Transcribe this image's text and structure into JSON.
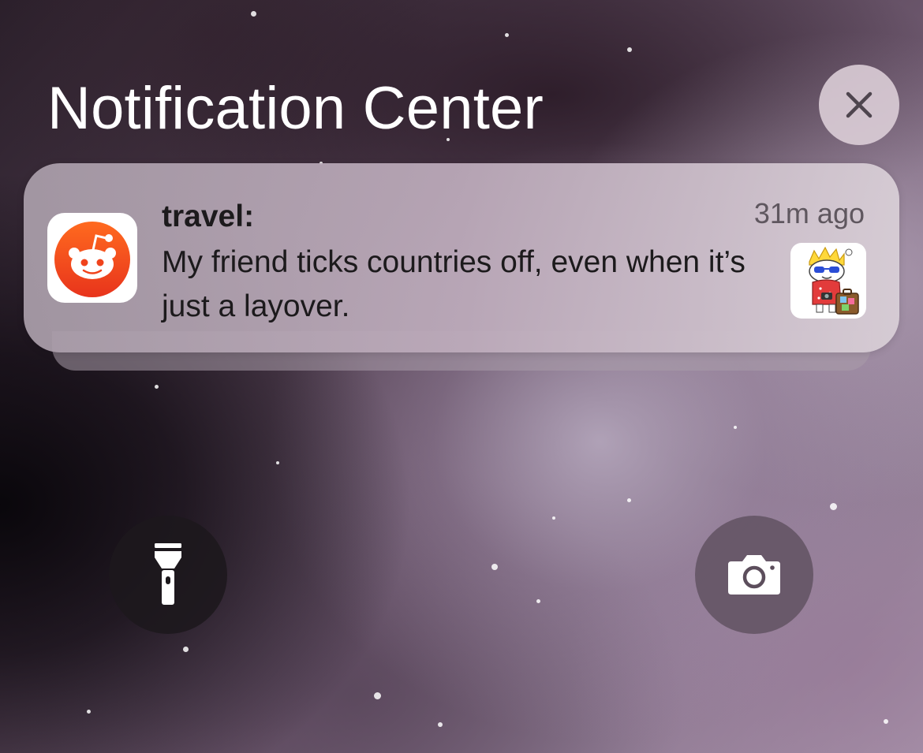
{
  "header": {
    "title": "Notification Center",
    "clear_icon": "close-x-icon"
  },
  "notification": {
    "app_icon": "reddit-app-icon",
    "title": "travel:",
    "time": "31m ago",
    "body": "My friend ticks countries off, even when it’s just a layover.",
    "thumbnail_icon": "snoo-traveler-avatar"
  },
  "quick_actions": {
    "flashlight_icon": "flashlight-icon",
    "camera_icon": "camera-icon"
  },
  "colors": {
    "reddit_orange": "#ff4500",
    "text_dark": "#1c1a1c",
    "text_muted": "#5f575f"
  }
}
